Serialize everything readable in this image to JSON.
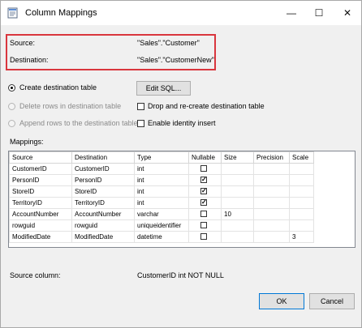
{
  "window": {
    "title": "Column Mappings",
    "minimize_glyph": "—",
    "maximize_glyph": "☐",
    "close_glyph": "✕"
  },
  "source_label": "Source:",
  "source_value": "\"Sales\".\"Customer\"",
  "destination_label": "Destination:",
  "destination_value": "\"Sales\".\"CustomerNew\"",
  "options": {
    "create_destination": "Create destination table",
    "delete_rows": "Delete rows in destination table",
    "append_rows": "Append rows to the destination table",
    "edit_sql": "Edit SQL...",
    "drop_recreate": "Drop and re-create destination table",
    "enable_identity": "Enable identity insert"
  },
  "mappings": {
    "label": "Mappings:",
    "columns": [
      "Source",
      "Destination",
      "Type",
      "Nullable",
      "Size",
      "Precision",
      "Scale"
    ],
    "rows": [
      {
        "source": "CustomerID",
        "destination": "CustomerID",
        "type": "int",
        "nullable": false,
        "size": "",
        "precision": "",
        "scale": ""
      },
      {
        "source": "PersonID",
        "destination": "PersonID",
        "type": "int",
        "nullable": true,
        "size": "",
        "precision": "",
        "scale": ""
      },
      {
        "source": "StoreID",
        "destination": "StoreID",
        "type": "int",
        "nullable": true,
        "size": "",
        "precision": "",
        "scale": ""
      },
      {
        "source": "TerritoryID",
        "destination": "TerritoryID",
        "type": "int",
        "nullable": true,
        "size": "",
        "precision": "",
        "scale": ""
      },
      {
        "source": "AccountNumber",
        "destination": "AccountNumber",
        "type": "varchar",
        "nullable": false,
        "size": "10",
        "precision": "",
        "scale": ""
      },
      {
        "source": "rowguid",
        "destination": "rowguid",
        "type": "uniqueidentifier",
        "nullable": false,
        "size": "",
        "precision": "",
        "scale": ""
      },
      {
        "source": "ModifiedDate",
        "destination": "ModifiedDate",
        "type": "datetime",
        "nullable": false,
        "size": "",
        "precision": "",
        "scale": "3"
      }
    ]
  },
  "source_column_label": "Source column:",
  "source_column_value": "CustomerID int NOT NULL",
  "buttons": {
    "ok": "OK",
    "cancel": "Cancel"
  },
  "colors": {
    "highlight_border": "#d9363e",
    "default_button_border": "#0078d7"
  }
}
